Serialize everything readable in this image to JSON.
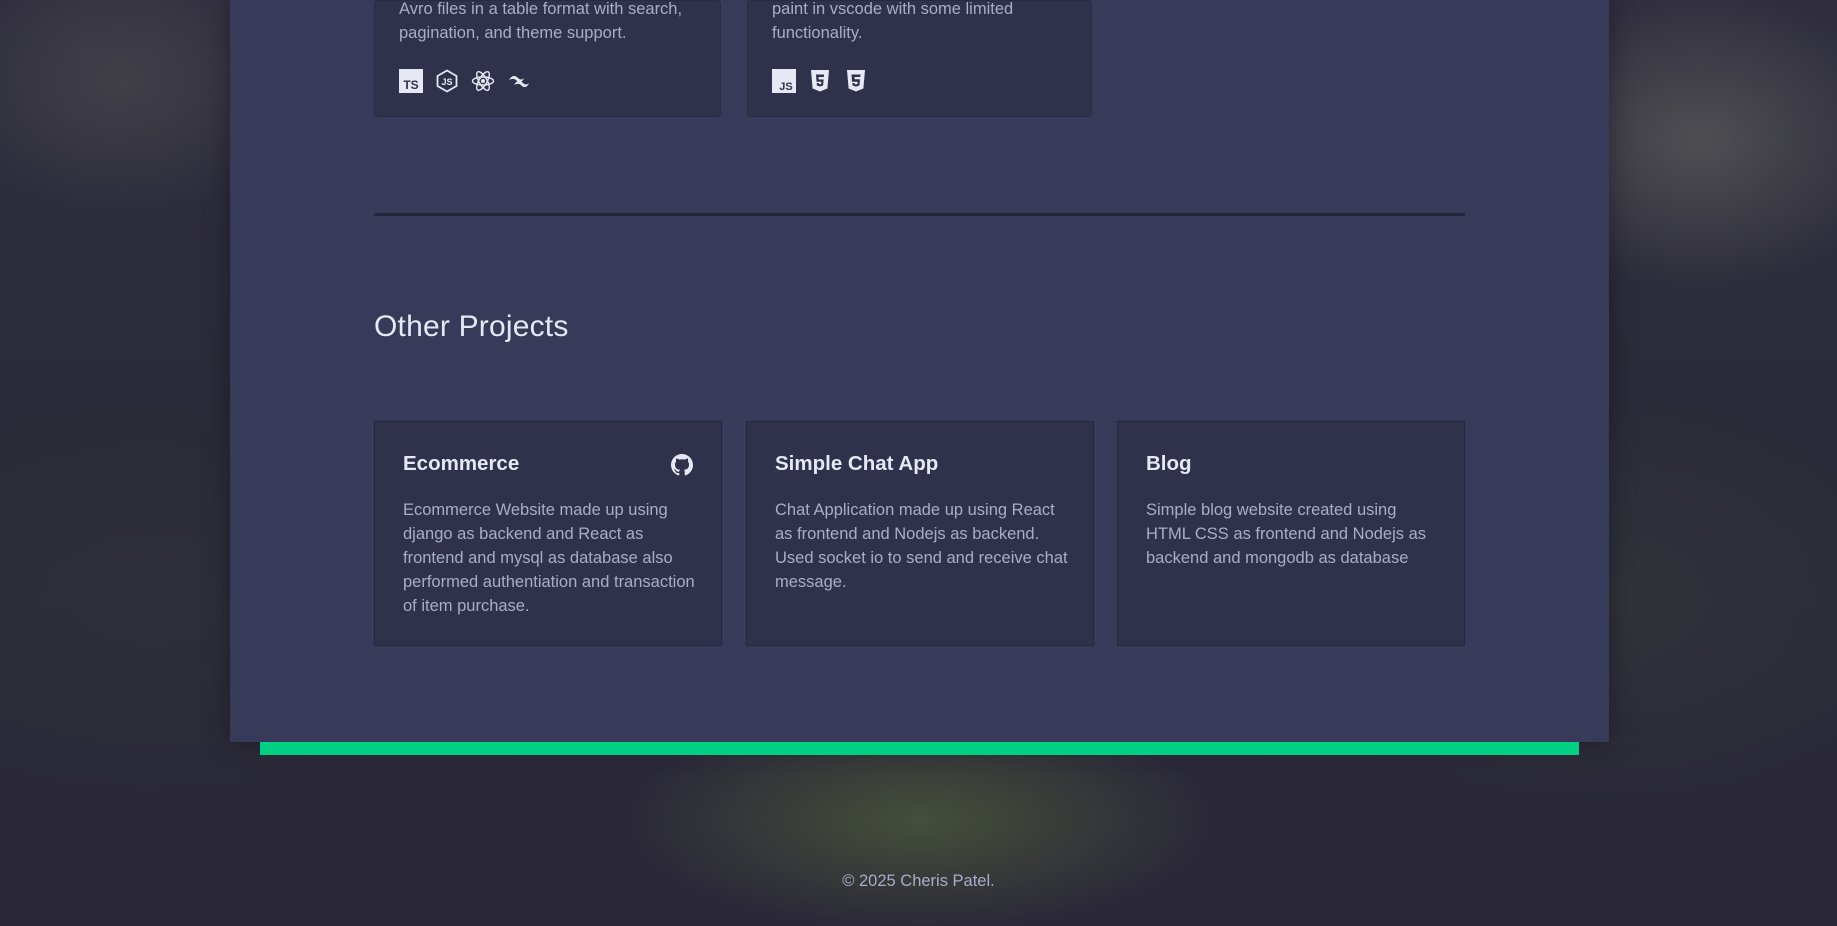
{
  "featured": [
    {
      "desc": "Avro files in a table format with search, pagination, and theme support.",
      "tech_icons": [
        "typescript-icon",
        "nodejs-icon",
        "react-icon",
        "tailwind-icon"
      ]
    },
    {
      "desc": "paint in vscode with some limited functionality.",
      "tech_icons": [
        "javascript-icon",
        "html5-icon",
        "css3-icon"
      ]
    }
  ],
  "other": {
    "title": "Other Projects",
    "projects": [
      {
        "name": "Ecommerce",
        "desc": "Ecommerce Website made up using django as backend and React as frontend and mysql as database also performed authentiation and transaction of item purchase.",
        "icon": "github-icon"
      },
      {
        "name": "Simple Chat App",
        "desc": "Chat Application made up using React as frontend and Nodejs as backend. Used socket io to send and receive chat message."
      },
      {
        "name": "Blog",
        "desc": "Simple blog website created using HTML CSS as frontend and Nodejs as backend and mongodb as database"
      }
    ]
  },
  "footer": {
    "text": "© 2025 Cheris Patel."
  },
  "colors": {
    "accent": "#00d084",
    "panel": "#383a59",
    "card": "#30324c"
  }
}
